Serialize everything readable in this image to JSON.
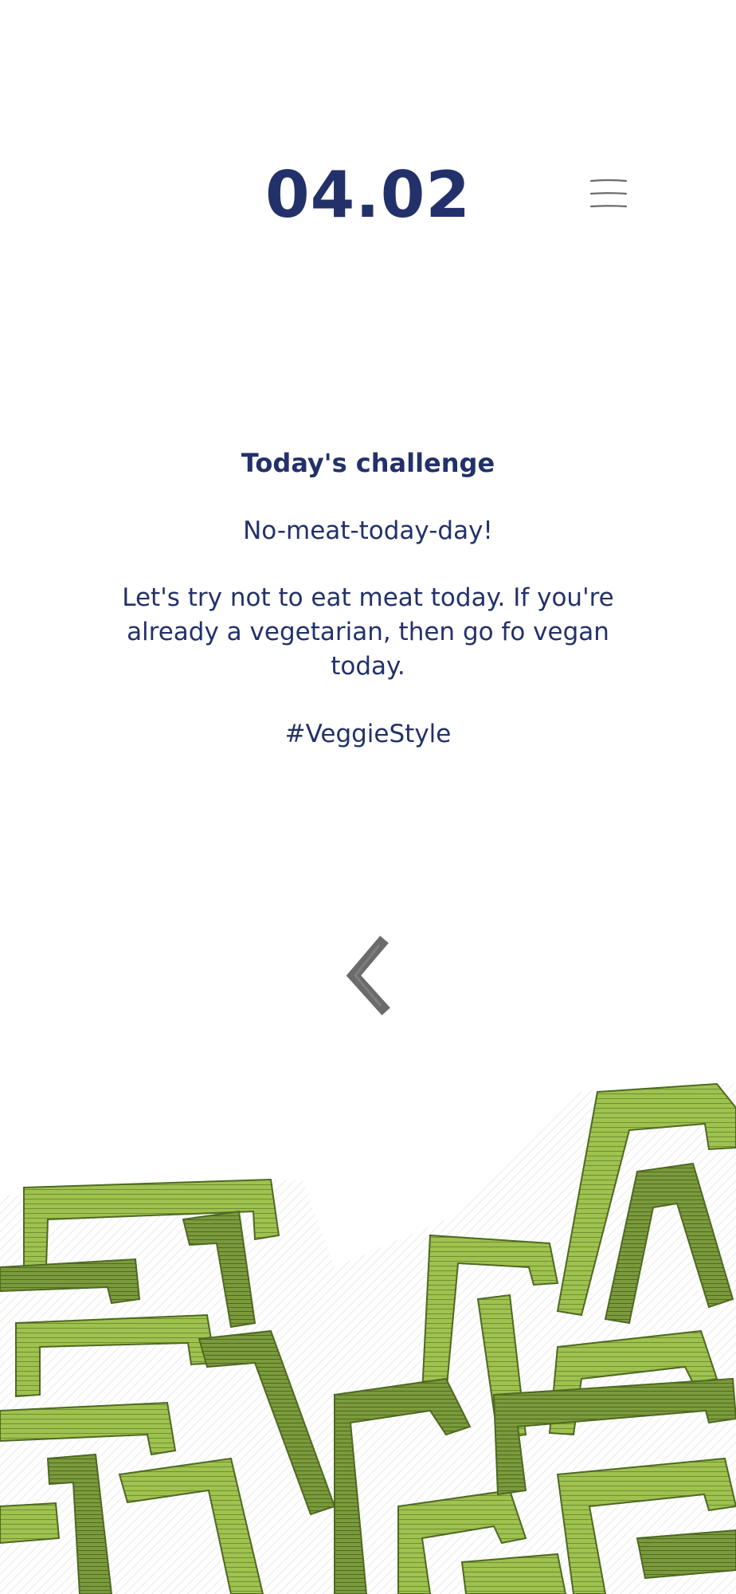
{
  "header": {
    "date": "04.02",
    "menu_icon": "hamburger-menu-icon"
  },
  "challenge": {
    "title": "Today's challenge",
    "name": "No-meat-today-day!",
    "description": "Let's try not to eat meat today. If you're already a vegetarian, then go fo vegan today.",
    "hashtag": "#VeggieStyle"
  },
  "navigation": {
    "back_icon": "chevron-left-icon"
  },
  "illustration": {
    "name": "green-maze-illustration"
  },
  "colors": {
    "text": "#23316a",
    "icon_gray": "#6b6b6b",
    "maze_green_light": "#a8c85a",
    "maze_green_dark": "#5f7f2e",
    "background": "#ffffff"
  }
}
